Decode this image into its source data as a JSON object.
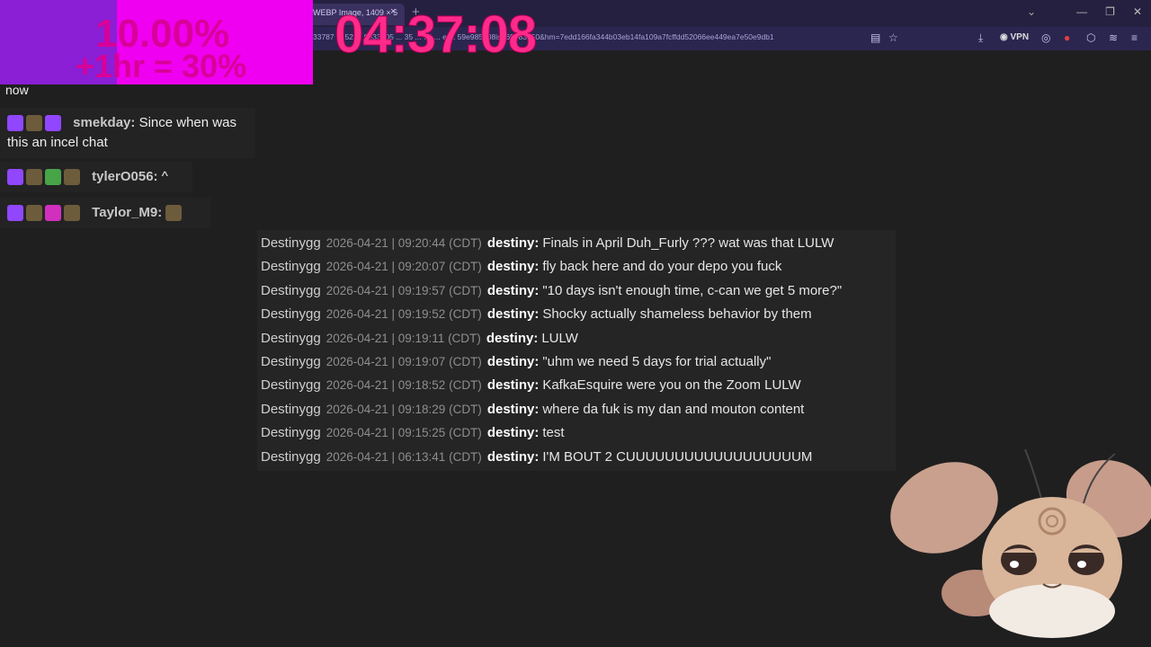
{
  "browser": {
    "tab_title": "WEBP Image, 1409 × 5",
    "tab_close": "×",
    "new_tab": "+",
    "url": "33787 ... 52 ... 9e33905 ... 35 ... 74 ... e ... 59e985d08is=69e83450&hm=7edd166fa344b03eb14fa109a7fcffdd52066ee449ea7e50e9db1",
    "vpn_label": "VPN"
  },
  "overlay": {
    "percent": "10.00%",
    "bonus": "+1hr = 30%",
    "timer": "04:37:08"
  },
  "twitch_chat": {
    "partial_text": "now",
    "messages": [
      {
        "user": "smekday:",
        "text": "Since when was this an incel chat"
      },
      {
        "user": "tylerO056:",
        "text": "^"
      },
      {
        "user": "Taylor_M9:",
        "text": ""
      }
    ]
  },
  "log": {
    "rows": [
      {
        "source": "Destinygg",
        "timestamp": "2026-04-21 | 09:20:44 (CDT)",
        "nick": "destiny:",
        "text": "Finals in April Duh_Furly ??? wat was that LULW"
      },
      {
        "source": "Destinygg",
        "timestamp": "2026-04-21 | 09:20:07 (CDT)",
        "nick": "destiny:",
        "text": "fly back here and do your depo you fuck"
      },
      {
        "source": "Destinygg",
        "timestamp": "2026-04-21 | 09:19:57 (CDT)",
        "nick": "destiny:",
        "text": "\"10 days isn't enough time, c-can we get 5 more?\""
      },
      {
        "source": "Destinygg",
        "timestamp": "2026-04-21 | 09:19:52 (CDT)",
        "nick": "destiny:",
        "text": "Shocky actually shameless behavior by them"
      },
      {
        "source": "Destinygg",
        "timestamp": "2026-04-21 | 09:19:11 (CDT)",
        "nick": "destiny:",
        "text": "LULW"
      },
      {
        "source": "Destinygg",
        "timestamp": "2026-04-21 | 09:19:07 (CDT)",
        "nick": "destiny:",
        "text": "\"uhm we need 5 days for trial actually\""
      },
      {
        "source": "Destinygg",
        "timestamp": "2026-04-21 | 09:18:52 (CDT)",
        "nick": "destiny:",
        "text": "KafkaEsquire were you on the Zoom LULW"
      },
      {
        "source": "Destinygg",
        "timestamp": "2026-04-21 | 09:18:29 (CDT)",
        "nick": "destiny:",
        "text": "where da fuk is my dan and mouton content"
      },
      {
        "source": "Destinygg",
        "timestamp": "2026-04-21 | 09:15:25 (CDT)",
        "nick": "destiny:",
        "text": "test"
      },
      {
        "source": "Destinygg",
        "timestamp": "2026-04-21 | 06:13:41 (CDT)",
        "nick": "destiny:",
        "text": "I'M BOUT 2 CUUUUUUUUUUUUUUUUUUM"
      }
    ]
  }
}
